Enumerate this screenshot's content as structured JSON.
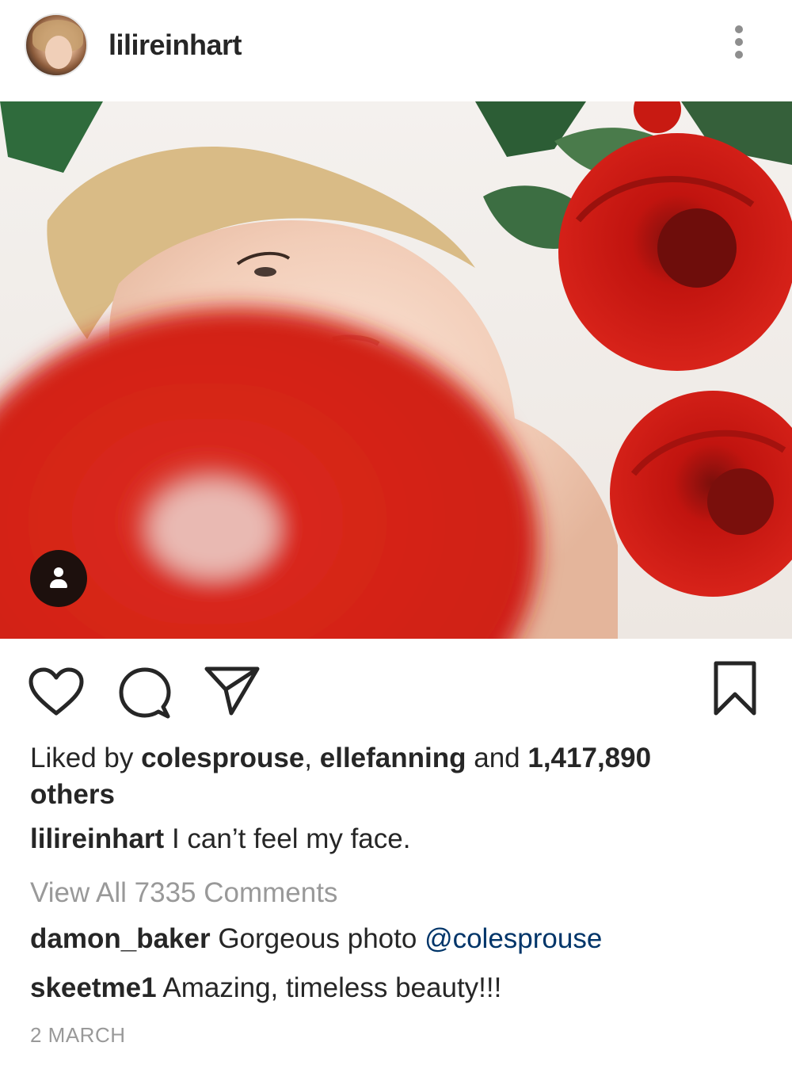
{
  "header": {
    "username": "lilireinhart",
    "avatar_icon": "profile-avatar",
    "more_icon": "more-vertical-icon"
  },
  "photo": {
    "tag_icon": "person-tag-icon"
  },
  "actions": {
    "like_icon": "heart-outline-icon",
    "comment_icon": "comment-bubble-icon",
    "share_icon": "paper-plane-icon",
    "save_icon": "bookmark-outline-icon"
  },
  "likes": {
    "prefix": "Liked by ",
    "user1": "colesprouse",
    "separator": ", ",
    "user2": "ellefanning",
    "connector": " and ",
    "count": "1,417,890",
    "suffix": "others"
  },
  "caption": {
    "username": "lilireinhart",
    "text": " I can’t feel my face."
  },
  "view_all_comments": "View All 7335 Comments",
  "comments": [
    {
      "username": "damon_baker",
      "text": " Gorgeous photo ",
      "mention": "@colesprouse"
    },
    {
      "username": "skeetme1",
      "text": " Amazing, timeless beauty!!!"
    }
  ],
  "date": "2 MARCH",
  "colors": {
    "text": "#262626",
    "muted": "#999999",
    "mention": "#003569",
    "rose": "#c81a12"
  }
}
